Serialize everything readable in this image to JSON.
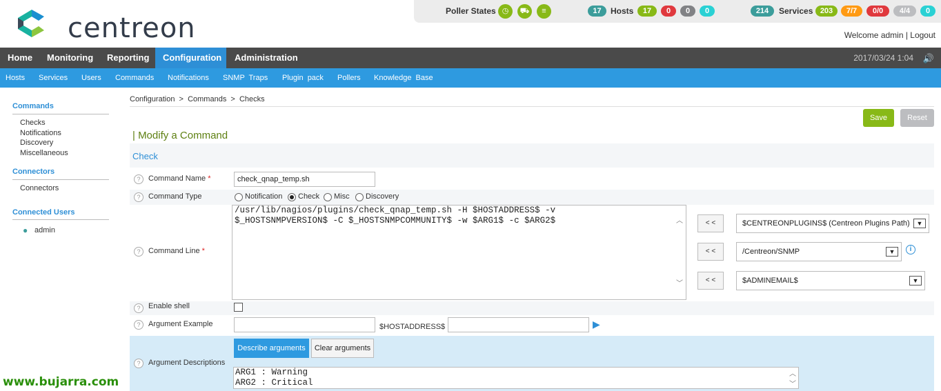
{
  "header": {
    "logo_text": "centreon",
    "poller_label": "Poller States",
    "hosts_label": "Hosts",
    "services_label": "Services",
    "hosts_total": "17",
    "hosts_up": "17",
    "hosts_down": "0",
    "hosts_unreachable": "0",
    "hosts_pending": "0",
    "services_total": "214",
    "services_ok": "203",
    "services_warning": "7/7",
    "services_critical": "0/0",
    "services_unknown": "4/4",
    "services_pending": "0",
    "welcome_text": "Welcome admin | Logout",
    "datetime": "2017/03/24 1:04"
  },
  "main_menu": [
    "Home",
    "Monitoring",
    "Reporting",
    "Configuration",
    "Administration"
  ],
  "sub_menu": [
    "Hosts",
    "Services",
    "Users",
    "Commands",
    "Notifications",
    "SNMP  Traps",
    "Plugin  pack",
    "Pollers",
    "Knowledge  Base"
  ],
  "sidebar": {
    "commands_title": "Commands",
    "commands_items": [
      "Checks",
      "Notifications",
      "Discovery",
      "Miscellaneous"
    ],
    "connectors_title": "Connectors",
    "connectors_items": [
      "Connectors"
    ],
    "connected_users_title": "Connected Users",
    "user": "admin"
  },
  "breadcrumb": "Configuration  >  Commands  >  Checks",
  "buttons": {
    "save": "Save",
    "reset": "Reset",
    "describe": "Describe arguments",
    "clear": "Clear arguments",
    "insert": "< <"
  },
  "page_title": "| Modify a Command",
  "section_title": "Check",
  "form": {
    "command_name_label": "Command Name",
    "command_name_value": "check_qnap_temp.sh",
    "command_type_label": "Command Type",
    "type_options": [
      "Notification",
      "Check",
      "Misc",
      "Discovery"
    ],
    "selected_type": "Check",
    "command_line_label": "Command Line",
    "command_line_value": "/usr/lib/nagios/plugins/check_qnap_temp.sh -H $HOSTADDRESS$ -v\n$_HOSTSNMPVERSION$ -C $_HOSTSNMPCOMMUNITY$ -w $ARG1$ -c $ARG2$",
    "macro_select_1": "$CENTREONPLUGINS$ (Centreon Plugins Path)",
    "macro_select_2": "/Centreon/SNMP",
    "macro_select_3": "$ADMINEMAIL$",
    "enable_shell_label": "Enable shell",
    "argument_example_label": "Argument Example",
    "hostaddress_label": "$HOSTADDRESS$",
    "argument_descriptions_label": "Argument Descriptions",
    "argument_descriptions_value": "ARG1 : Warning\nARG2 : Critical"
  },
  "watermark": "www.bujarra.com"
}
